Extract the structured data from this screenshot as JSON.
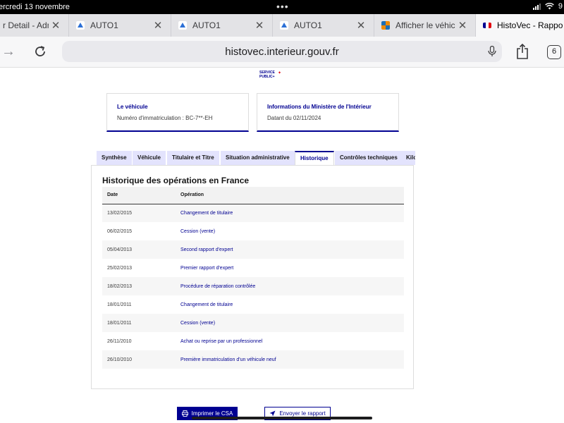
{
  "status_bar": {
    "time_date": "ercredi 13 novembre",
    "battery": "9"
  },
  "browser_tabs": [
    {
      "title": "r Detail - Adm",
      "favicon": "page-icon",
      "active": false
    },
    {
      "title": "AUTO1",
      "favicon": "auto1-icon",
      "active": false
    },
    {
      "title": "AUTO1",
      "favicon": "auto1-icon",
      "active": false
    },
    {
      "title": "AUTO1",
      "favicon": "auto1-icon",
      "active": false
    },
    {
      "title": "Afficher le véhic",
      "favicon": "grid-icon",
      "active": false
    },
    {
      "title": "HistoVec - Rappo",
      "favicon": "french-flag-icon",
      "active": true
    }
  ],
  "address_bar": {
    "url": "histovec.interieur.gouv.fr",
    "tab_count": "6"
  },
  "logo_text": "SERVICE PUBLIC+",
  "vehicle_card": {
    "title": "Le véhicule",
    "text": "Numéro d'immatriculation : BC-7**-EH"
  },
  "ministry_card": {
    "title": "Informations du Ministère de l'Intérieur",
    "text": "Datant du 02/11/2024"
  },
  "report_tabs": [
    {
      "label": "Synthèse",
      "active": false
    },
    {
      "label": "Véhicule",
      "active": false
    },
    {
      "label": "Titulaire et Titre",
      "active": false
    },
    {
      "label": "Situation administrative",
      "active": false
    },
    {
      "label": "Historique",
      "active": true
    },
    {
      "label": "Contrôles techniques",
      "active": false
    },
    {
      "label": "Kilométrage",
      "active": false
    }
  ],
  "history": {
    "title": "Historique des opérations en France",
    "columns": [
      "Date",
      "Opération"
    ],
    "rows": [
      {
        "date": "13/02/2015",
        "operation": "Changement de titulaire"
      },
      {
        "date": "06/02/2015",
        "operation": "Cession (vente)"
      },
      {
        "date": "05/04/2013",
        "operation": "Second rapport d'expert"
      },
      {
        "date": "25/02/2013",
        "operation": "Premier rapport d'expert"
      },
      {
        "date": "18/02/2013",
        "operation": "Procédure de réparation contrôlée"
      },
      {
        "date": "18/01/2011",
        "operation": "Changement de titulaire"
      },
      {
        "date": "18/01/2011",
        "operation": "Cession (vente)"
      },
      {
        "date": "26/11/2010",
        "operation": "Achat ou reprise par un professionnel"
      },
      {
        "date": "26/10/2010",
        "operation": "Première immatriculation d'un véhicule neuf"
      }
    ]
  },
  "actions": {
    "print_label": "Imprimer le CSA",
    "send_label": "Envoyer le rapport"
  },
  "colors": {
    "accent": "#000091",
    "tab_bg": "#e3e3fd",
    "marianne_red": "#e1000f"
  }
}
